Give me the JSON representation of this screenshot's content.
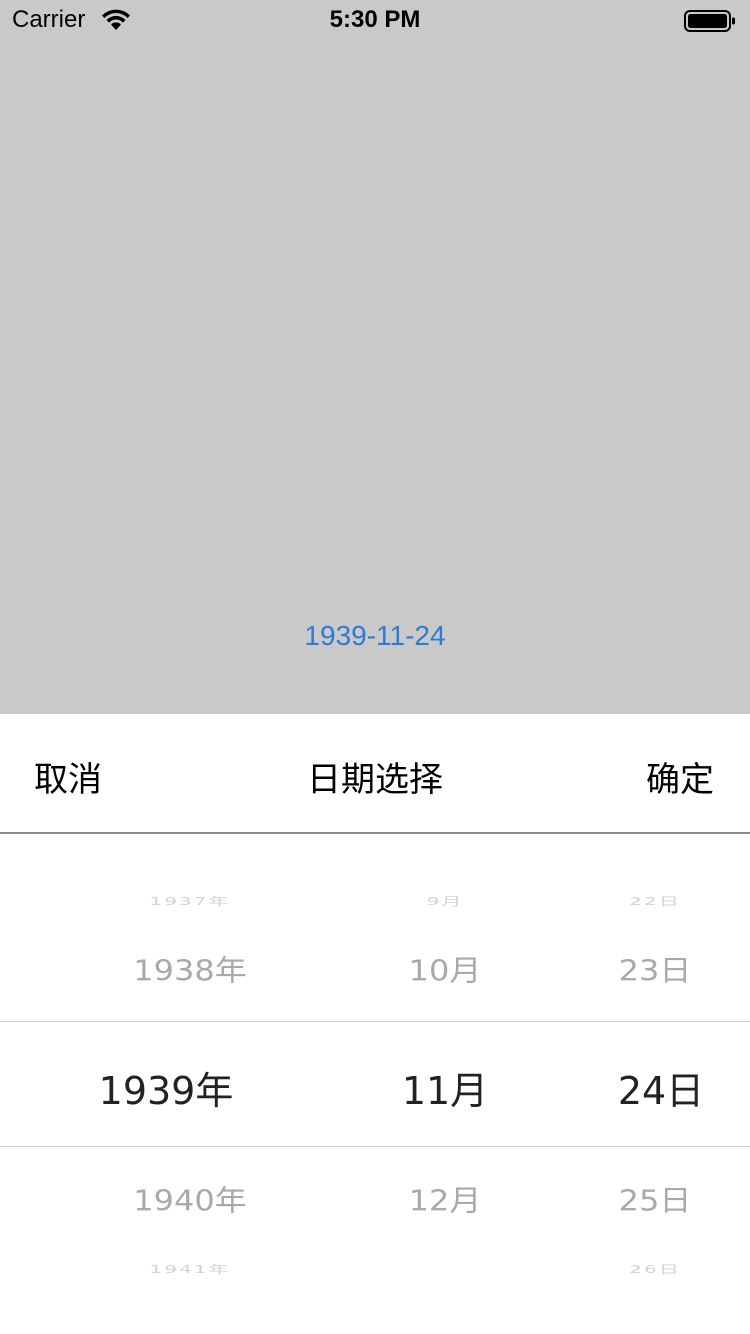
{
  "status_bar": {
    "carrier": "Carrier",
    "time": "5:30 PM",
    "wifi_icon": "wifi-icon",
    "battery_icon": "battery-icon"
  },
  "selected_date": "1939-11-24",
  "sheet": {
    "cancel_label": "取消",
    "title": "日期选择",
    "confirm_label": "确定"
  },
  "picker": {
    "year": {
      "far_top": "1937年",
      "near_top": "1938年",
      "selected": "1939年",
      "near_bottom": "1940年",
      "far_bottom": "1941年"
    },
    "month": {
      "far_top": "9月",
      "near_top": "10月",
      "selected": "11月",
      "near_bottom": "12月"
    },
    "day": {
      "far_top": "22日",
      "near_top": "23日",
      "selected": "24日",
      "near_bottom": "25日",
      "far_bottom": "26日"
    }
  },
  "colors": {
    "background_dim": "#c9c9c9",
    "accent": "#2d7bd4",
    "sheet": "#ffffff"
  }
}
